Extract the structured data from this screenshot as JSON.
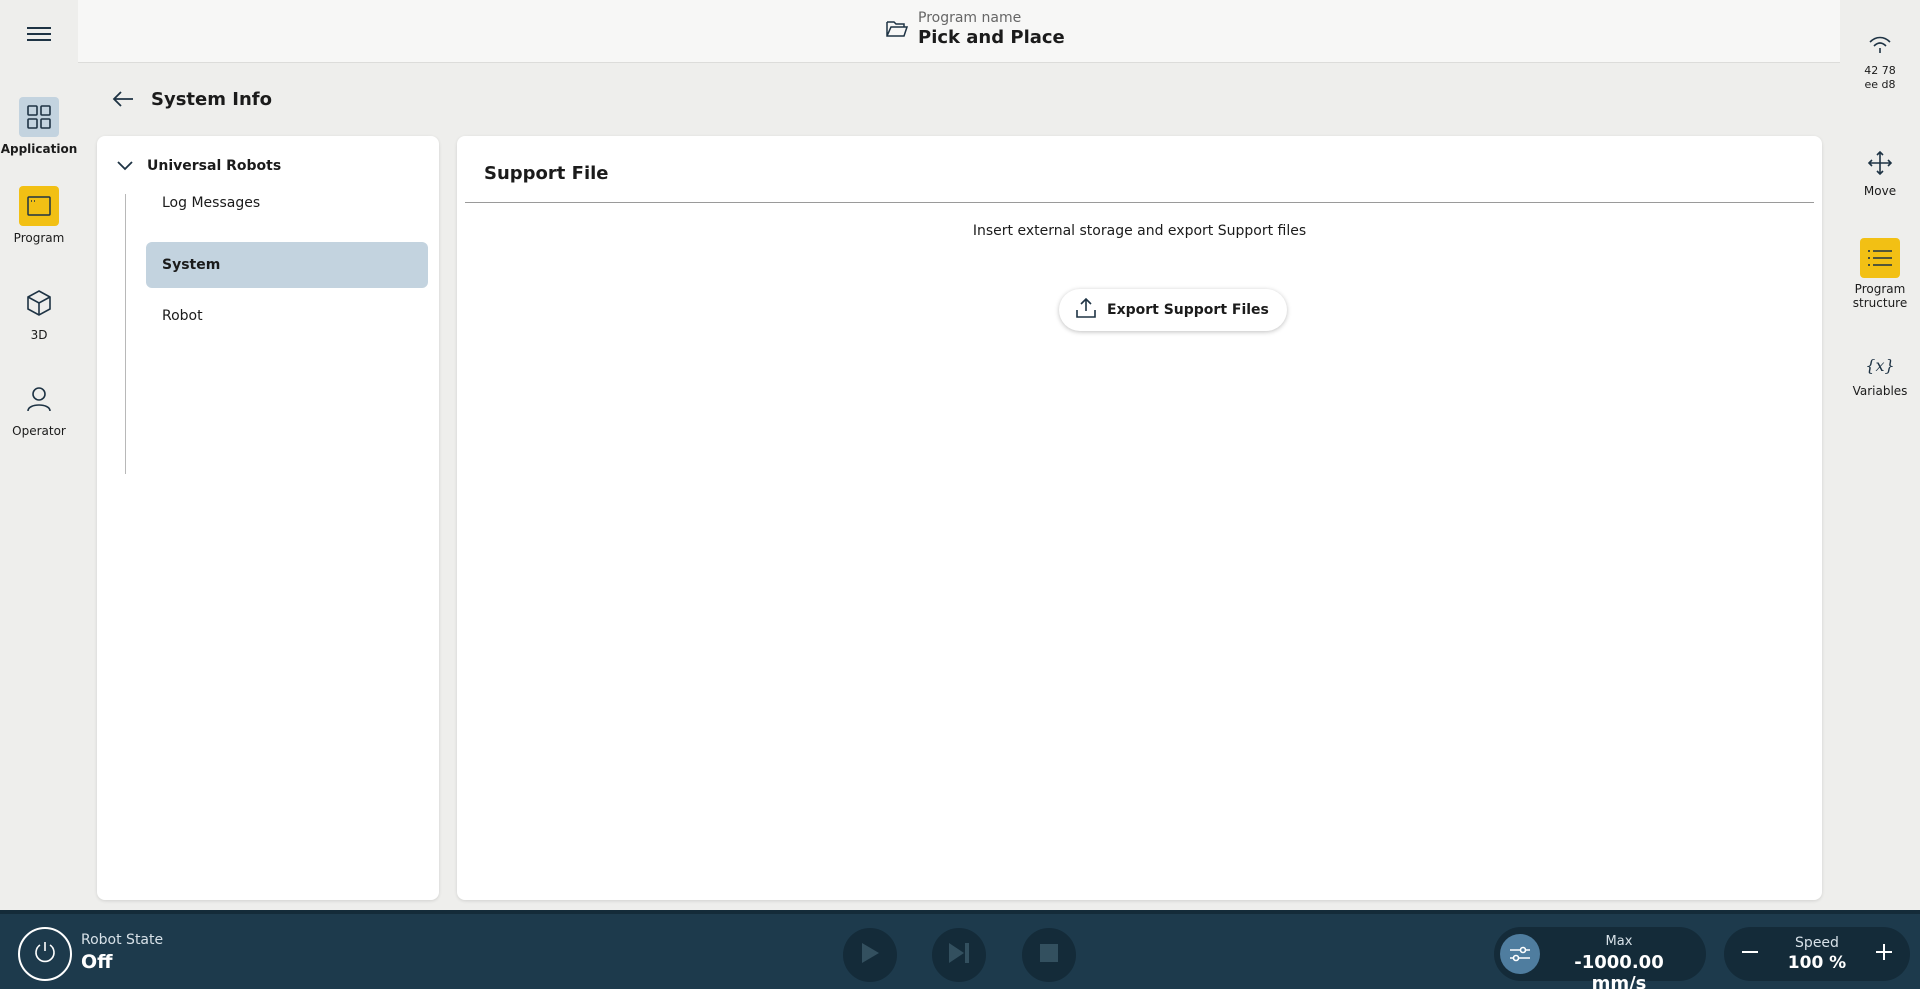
{
  "nav": {
    "items": [
      {
        "label": "Application",
        "icon": "grid-icon"
      },
      {
        "label": "Program",
        "icon": "program-window-icon"
      },
      {
        "label": "3D",
        "icon": "cube-icon"
      },
      {
        "label": "Operator",
        "icon": "person-icon"
      }
    ]
  },
  "header": {
    "program_caption": "Program name",
    "program_name": "Pick and Place"
  },
  "right_rail": {
    "network_id": [
      "42 78",
      "ee d8"
    ],
    "items": [
      {
        "label": "Move",
        "icon": "move-arrows-icon"
      },
      {
        "label_line1": "Program",
        "label_line2": "structure",
        "icon": "list-icon"
      },
      {
        "label": "Variables",
        "icon": "variables-icon"
      }
    ]
  },
  "page": {
    "title": "System Info"
  },
  "tree": {
    "root": "Universal Robots",
    "items": [
      {
        "label": "Log Messages",
        "selected": false
      },
      {
        "label": "System",
        "selected": true
      },
      {
        "label": "Robot",
        "selected": false
      }
    ]
  },
  "content": {
    "title": "Support File",
    "description": "Insert external storage and export Support files",
    "export_button": "Export Support Files"
  },
  "bottom": {
    "robot_state_caption": "Robot State",
    "robot_state_value": "Off",
    "max_caption": "Max",
    "max_value": "-1000.00 mm/s",
    "speed_caption": "Speed",
    "speed_value": "100 %"
  },
  "colors": {
    "accent_yellow": "#f2c014",
    "selection_blue": "#c3d3df",
    "bottom_bar": "#1d3a4c"
  }
}
